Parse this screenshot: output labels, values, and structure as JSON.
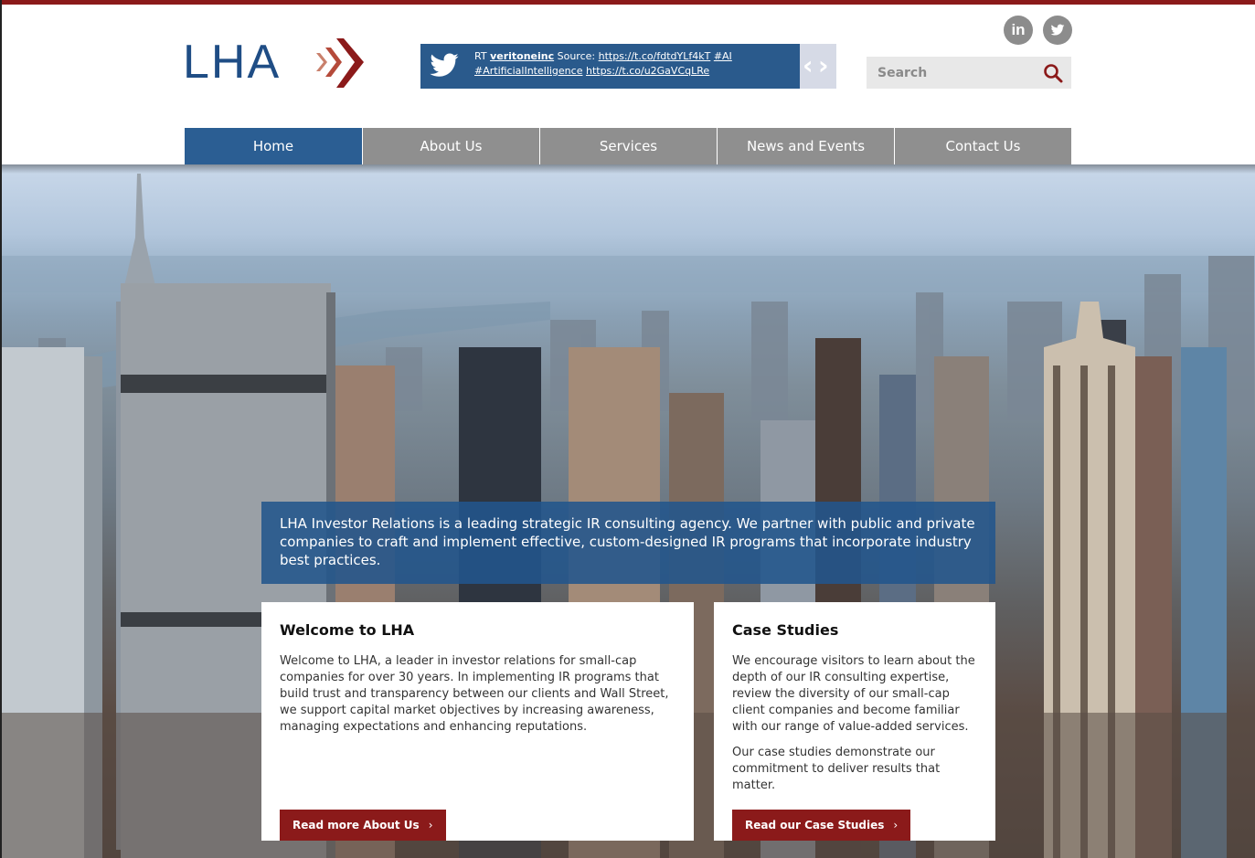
{
  "header": {
    "logo_text": "LHA",
    "tweet": {
      "prefix": "RT",
      "user": "veritoneinc",
      "source_label": "Source:",
      "link1": "https://t.co/fdtdYLf4kT",
      "hashtag1": "#AI",
      "hashtag2": "#ArtificialIntelligence",
      "link2": "https://t.co/u2GaVCqLRe",
      "prev": "‹",
      "next": "›"
    },
    "social": {
      "linkedin": "in"
    },
    "search": {
      "placeholder": "Search"
    }
  },
  "nav": {
    "items": [
      {
        "label": "Home"
      },
      {
        "label": "About Us"
      },
      {
        "label": "Services"
      },
      {
        "label": "News and Events"
      },
      {
        "label": "Contact Us"
      }
    ]
  },
  "hero": {
    "tagline": "LHA Investor Relations is a leading strategic IR consulting agency. We partner with public and private companies to craft and implement effective, custom-designed IR programs that incorporate industry best practices."
  },
  "cards": {
    "welcome": {
      "title": "Welcome to LHA",
      "body": "Welcome to LHA, a leader in investor relations for small-cap companies for over 30 years. In implementing IR programs that build trust and transparency between our clients and Wall Street, we support capital market objectives by increasing awareness, managing expectations and enhancing reputations.",
      "button": "Read more About Us"
    },
    "case_studies": {
      "title": "Case Studies",
      "body1": "We encourage visitors to learn about the depth of our IR consulting expertise, review the diversity of our small-cap client companies and become familiar with our range of value-added services.",
      "body2": "Our case studies demonstrate our commitment to deliver results that matter.",
      "button": "Read our Case Studies"
    },
    "chevron": "›"
  },
  "colors": {
    "brand_blue": "#2b5e93",
    "brand_red": "#8b1a1a",
    "nav_gray": "#8f8f8f"
  },
  "icons": {
    "logo_arrows": "double-chevron-right-icon",
    "tweet": "twitter-bird-icon",
    "linkedin": "linkedin-icon",
    "twitter": "twitter-icon",
    "search": "magnifier-icon"
  }
}
